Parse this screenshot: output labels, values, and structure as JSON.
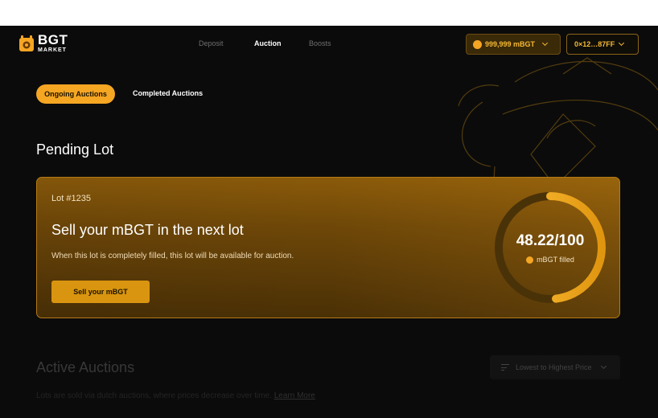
{
  "brand": {
    "name": "BGT",
    "sub": "MARKET"
  },
  "nav": {
    "items": [
      {
        "label": "Deposit",
        "active": false
      },
      {
        "label": "Auction",
        "active": true
      },
      {
        "label": "Boosts",
        "active": false
      }
    ]
  },
  "wallet": {
    "balance": "999,999 mBGT",
    "address": "0×12…87FF"
  },
  "tabs": {
    "ongoing": "Ongoing Auctions",
    "completed": "Completed Auctions"
  },
  "pending": {
    "section_title": "Pending Lot",
    "lot_number": "Lot #1235",
    "title": "Sell your mBGT in the next lot",
    "description": "When this lot is completely filled, this lot will be available for auction.",
    "button": "Sell your mBGT",
    "fill_text": "48.22/100",
    "fill_label": "mBGT filled",
    "fill_fraction": 0.4822
  },
  "active": {
    "title": "Active Auctions",
    "description": "Lots are sold via dutch auctions, where prices decrease over time.",
    "learn_more": "Learn More",
    "sort_label": "Lowest to Highest Price"
  },
  "colors": {
    "accent": "#f5a623",
    "background": "#0b0b0b",
    "card": "#6e4708"
  }
}
